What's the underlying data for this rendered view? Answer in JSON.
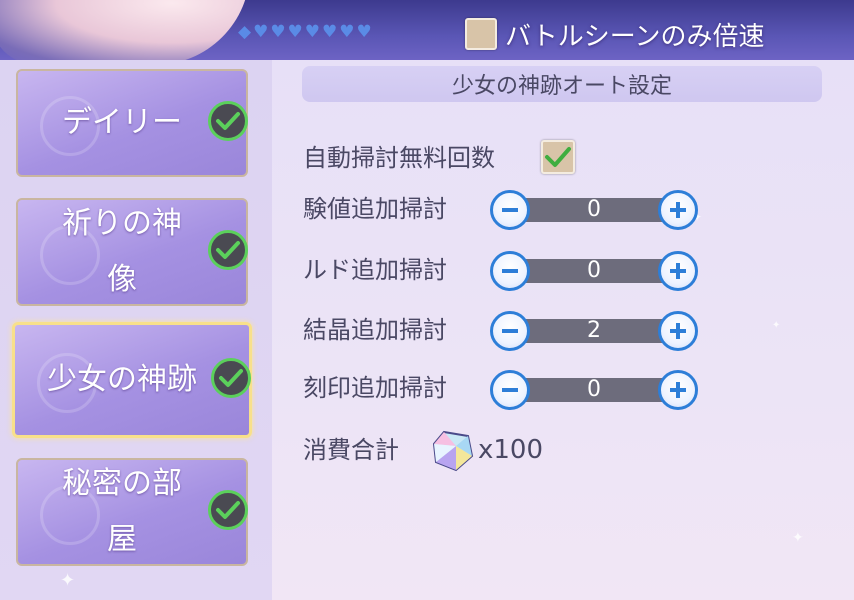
{
  "header": {
    "hearts": "◆♥♥♥♥♥♥♥",
    "speed_toggle_label": "バトルシーンのみ倍速",
    "speed_toggle_checked": false
  },
  "modes": [
    {
      "label": "デイリー",
      "checked": true,
      "selected": false
    },
    {
      "label": "祈りの神像",
      "checked": true,
      "selected": false
    },
    {
      "label": "少女の神跡",
      "checked": true,
      "selected": true
    },
    {
      "label": "秘密の部屋",
      "checked": true,
      "selected": false
    }
  ],
  "settings": {
    "title": "少女の神跡オート設定",
    "auto_free_label": "自動掃討無料回数",
    "auto_free_checked": true,
    "rows": [
      {
        "label": "験値追加掃討",
        "value": "0"
      },
      {
        "label": "ルド追加掃討",
        "value": "0"
      },
      {
        "label": "結晶追加掃討",
        "value": "2"
      },
      {
        "label": "刻印追加掃討",
        "value": "0"
      }
    ],
    "cost_label": "消費合計",
    "cost_value": "x100",
    "cost_icon": "crystal-gem-icon"
  },
  "colors": {
    "check_green": "#5bd05b",
    "stepper_blue": "#2d7ed8",
    "selected_border": "#f8e08a"
  }
}
